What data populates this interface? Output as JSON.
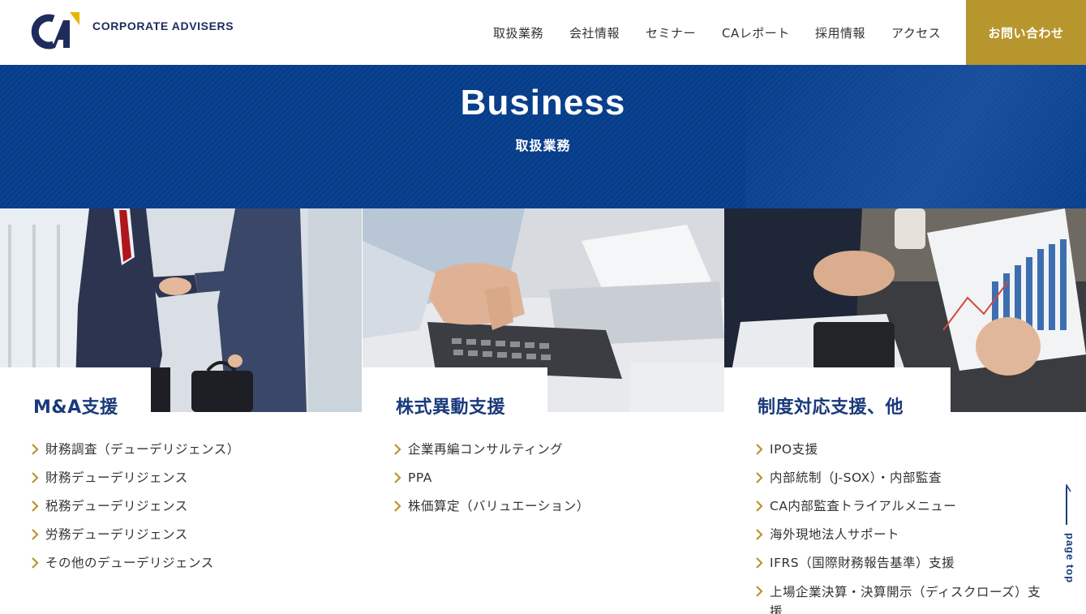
{
  "header": {
    "logo_text": "CORPORATE ADVISERS",
    "nav": [
      "取扱業務",
      "会社情報",
      "セミナー",
      "CAレポート",
      "採用情報",
      "アクセス"
    ],
    "contact_label": "お問い合わせ"
  },
  "hero": {
    "title": "Business",
    "subtitle": "取扱業務"
  },
  "cards": [
    {
      "title": "M&A支援",
      "image": "handshake-photo",
      "items": [
        "財務調査（デューデリジェンス）",
        "財務デューデリジェンス",
        "税務デューデリジェンス",
        "労務デューデリジェンス",
        "その他のデューデリジェンス"
      ]
    },
    {
      "title": "株式異動支援",
      "image": "calculator-photo",
      "items": [
        "企業再編コンサルティング",
        "PPA",
        "株価算定（バリュエーション）"
      ]
    },
    {
      "title": "制度対応支援、他",
      "image": "tablet-chart-photo",
      "items": [
        "IPO支援",
        "内部統制（J-SOX）・内部監査",
        "CA内部監査トライアルメニュー",
        "海外現地法人サポート",
        "IFRS（国際財務報告基準）支援",
        "上場企業決算・決算開示（ディスクローズ）支援"
      ]
    }
  ],
  "pagetop_label": "page top",
  "colors": {
    "navy": "#063d8a",
    "gold": "#b8962e",
    "title_blue": "#1a3a7a"
  }
}
